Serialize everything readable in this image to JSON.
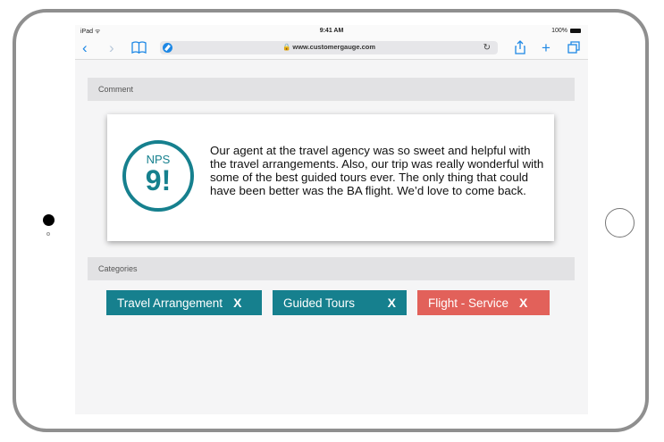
{
  "status_bar": {
    "device": "iPad ᯤ",
    "time": "9:41 AM",
    "battery": "100%"
  },
  "browser": {
    "url": "🔒 www.customergauge.com"
  },
  "comment_section": {
    "header": "Comment",
    "nps_label": "NPS",
    "nps_score": "9!",
    "text": "Our agent at the travel agency was so sweet and helpful with the travel arrangements. Also, our trip was really wonderful with some of the best guided tours ever. The only thing that could have been better was the BA flight. We’d love to come back."
  },
  "categories_section": {
    "header": "Categories",
    "tags": [
      {
        "label": "Travel Arrangement",
        "remove": "X",
        "color": "#16808e"
      },
      {
        "label": "Guided Tours",
        "remove": "X",
        "color": "#16808e"
      },
      {
        "label": "Flight - Service",
        "remove": "X",
        "color": "#e2615a"
      }
    ]
  },
  "colors": {
    "accent": "#16808e",
    "negative": "#e2615a",
    "safari_blue": "#1e88e5"
  }
}
